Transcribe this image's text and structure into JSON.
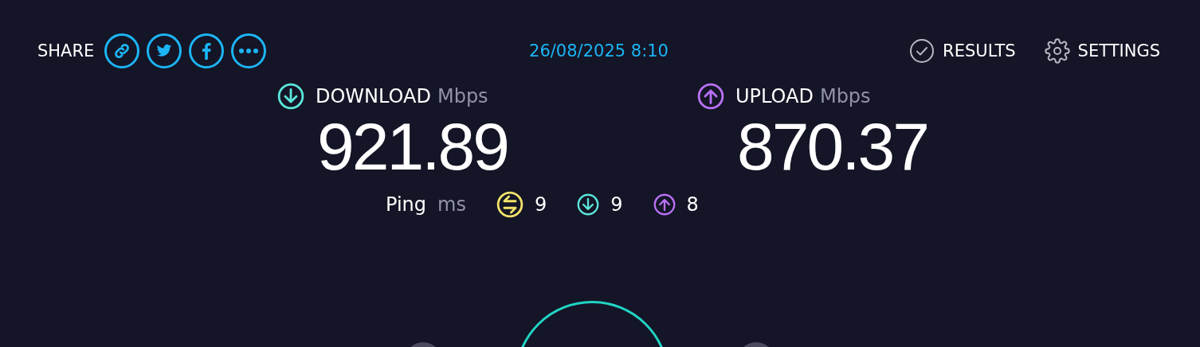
{
  "share": {
    "label": "SHARE",
    "buttons": [
      {
        "kind": "link"
      },
      {
        "kind": "twitter"
      },
      {
        "kind": "facebook"
      },
      {
        "kind": "more"
      }
    ]
  },
  "timestamp": "26/08/2025 8:10",
  "nav": [
    {
      "kind": "results",
      "label": "RESULTS"
    },
    {
      "kind": "settings",
      "label": "SETTINGS"
    }
  ],
  "metrics": [
    {
      "kind": "download",
      "label": "DOWNLOAD",
      "unit": "Mbps",
      "value": "921.89"
    },
    {
      "kind": "upload",
      "label": "UPLOAD",
      "unit": "Mbps",
      "value": "870.37"
    }
  ],
  "ping": {
    "label": "Ping",
    "unit": "ms",
    "readings": [
      {
        "kind": "idle",
        "value": "9"
      },
      {
        "kind": "download",
        "value": "9"
      },
      {
        "kind": "upload",
        "value": "8"
      }
    ]
  }
}
